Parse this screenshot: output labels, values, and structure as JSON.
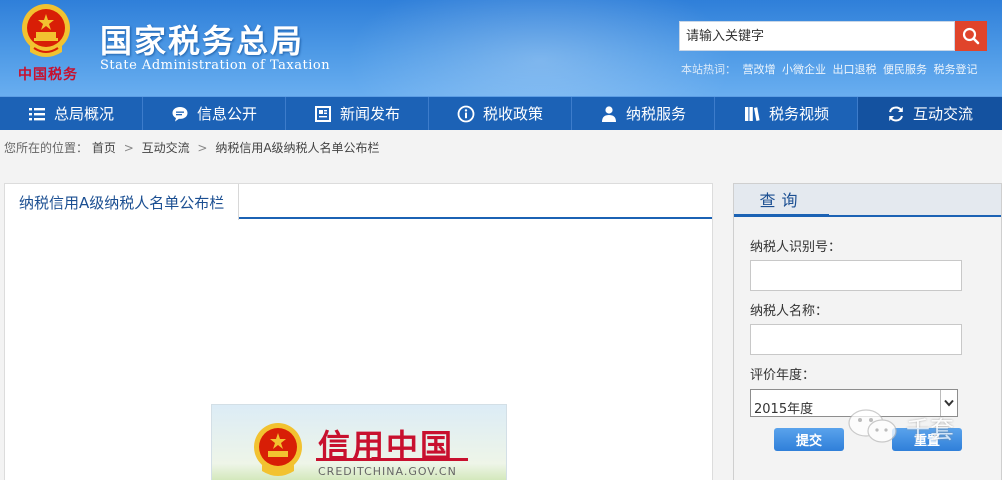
{
  "header": {
    "title": "国家税务总局",
    "subtitle": "State Administration of Taxation",
    "emblem_caption": "中国税务",
    "search": {
      "placeholder": "请输入关键字"
    },
    "hot_label": "本站热词：",
    "hot_words": [
      "营改增",
      "小微企业",
      "出口退税",
      "便民服务",
      "税务登记"
    ]
  },
  "nav": {
    "items": [
      {
        "label": "总局概况",
        "icon": "menu-icon"
      },
      {
        "label": "信息公开",
        "icon": "chat-bubble-icon"
      },
      {
        "label": "新闻发布",
        "icon": "newspaper-icon"
      },
      {
        "label": "税收政策",
        "icon": "info-icon"
      },
      {
        "label": "纳税服务",
        "icon": "person-icon"
      },
      {
        "label": "税务视频",
        "icon": "book-icon"
      },
      {
        "label": "互动交流",
        "icon": "refresh-arrows-icon"
      }
    ],
    "active_index": 6
  },
  "breadcrumb": {
    "prefix": "您所在的位置：",
    "items": [
      "首页",
      "互动交流",
      "纳税信用A级纳税人名单公布栏"
    ],
    "separator": ">"
  },
  "main": {
    "tab_label": "纳税信用A级纳税人名单公布栏",
    "banner": {
      "title": "信用中国",
      "url": "CREDITCHINA.GOV.CN"
    }
  },
  "query": {
    "title": "查询",
    "taxpayer_id_label": "纳税人识别号：",
    "taxpayer_id_value": "",
    "taxpayer_name_label": "纳税人名称：",
    "taxpayer_name_value": "",
    "year_label": "评价年度：",
    "year_selected": "2015年度",
    "submit_label": "提交",
    "reset_label": "重置"
  },
  "watermark": {
    "text": "千套"
  },
  "colors": {
    "header_blue": "#2f7fd9",
    "nav_blue": "#1c62b6",
    "search_button_red": "#e0442b",
    "credit_red": "#c8102e"
  }
}
